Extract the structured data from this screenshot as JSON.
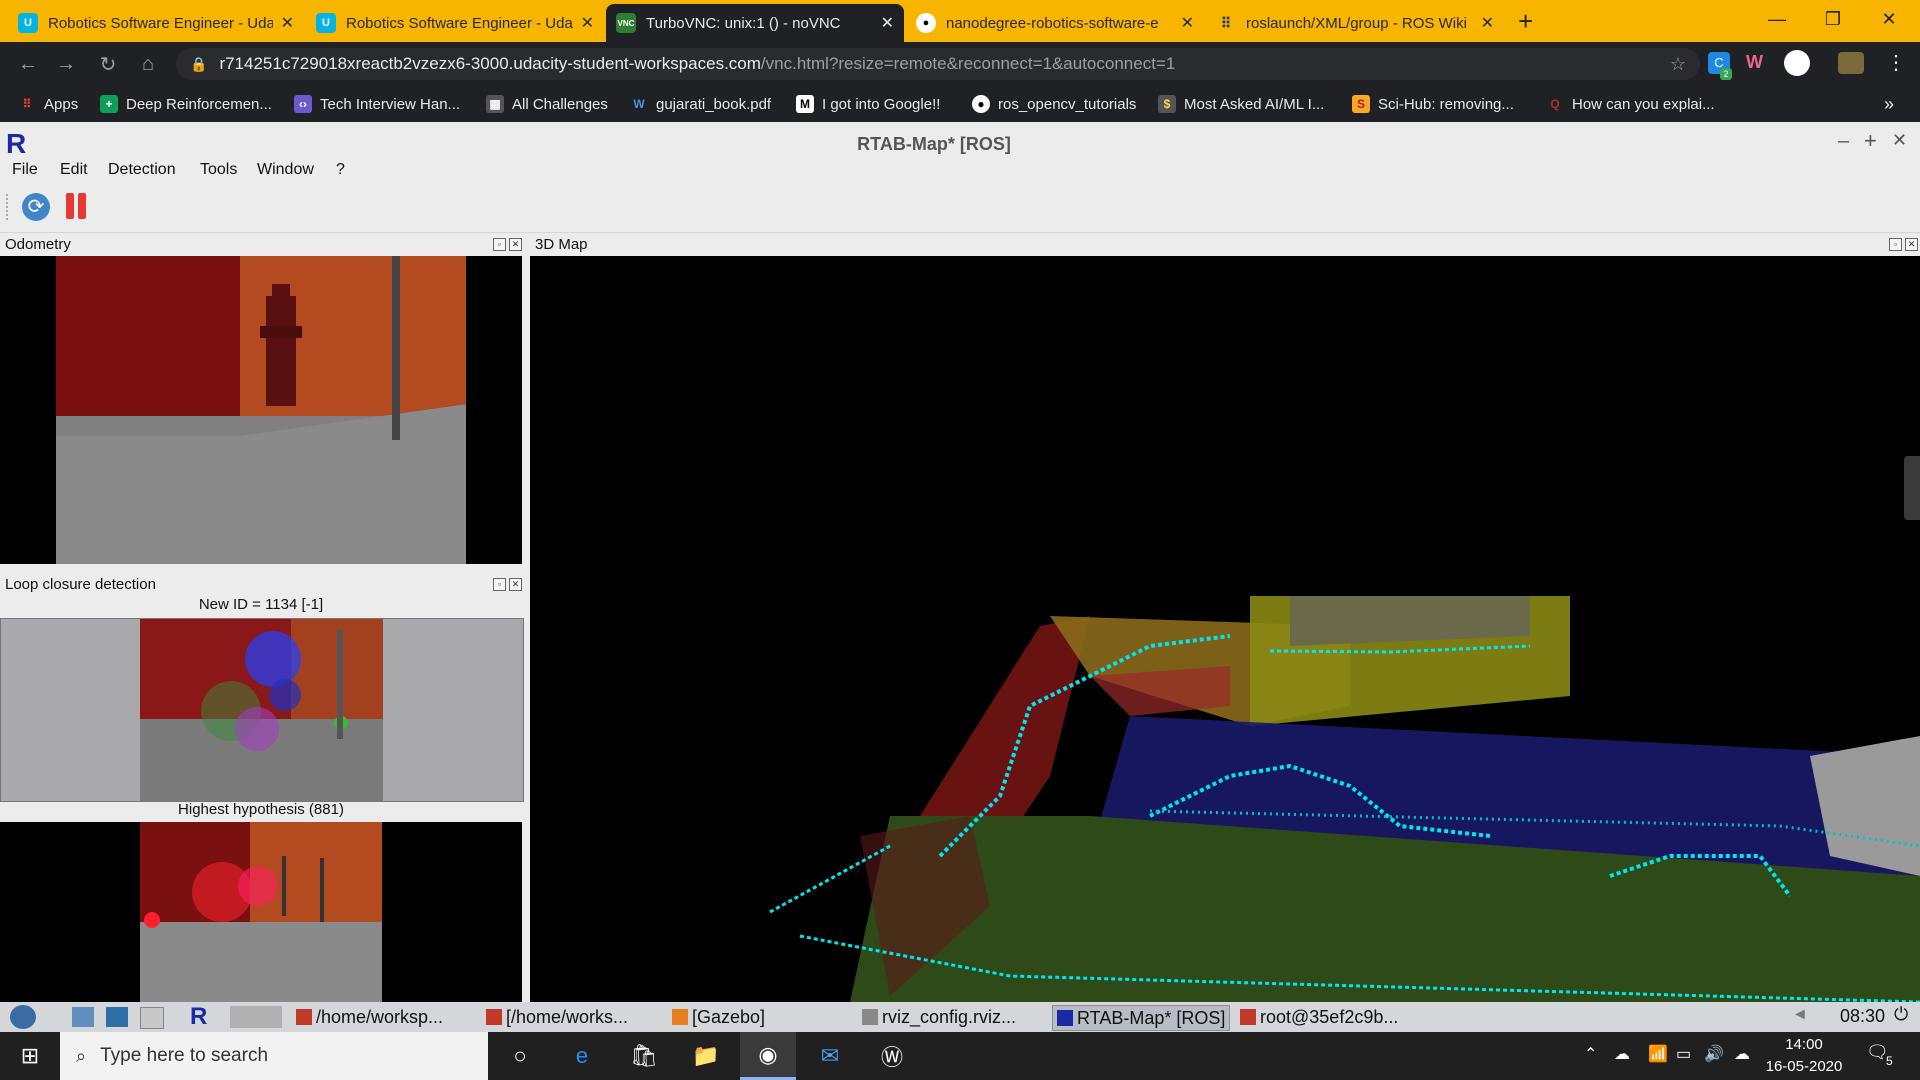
{
  "browser": {
    "tabs": [
      {
        "title": "Robotics Software Engineer - Uda",
        "icon": "udacity-icon"
      },
      {
        "title": "Robotics Software Engineer - Uda",
        "icon": "udacity-icon"
      },
      {
        "title": "TurboVNC: unix:1 () - noVNC",
        "icon": "vnc-icon",
        "active": true
      },
      {
        "title": "nanodegree-robotics-software-e",
        "icon": "github-icon"
      },
      {
        "title": "roslaunch/XML/group - ROS Wiki",
        "icon": "ros-icon"
      }
    ],
    "address_host": "r714251c729018xreactb2vzezx6-3000.udacity-student-workspaces.com",
    "address_path": "/vnc.html?resize=remote&reconnect=1&autoconnect=1",
    "extension_badge": "2",
    "bookmarks": [
      {
        "label": "Apps",
        "icon": "apps-grid-icon"
      },
      {
        "label": "Deep Reinforcemen...",
        "icon": "plus-icon"
      },
      {
        "label": "Tech Interview Han...",
        "icon": "code-icon"
      },
      {
        "label": "All Challenges",
        "icon": "challenge-icon"
      },
      {
        "label": "gujarati_book.pdf",
        "icon": "w-icon"
      },
      {
        "label": "I got into Google!!",
        "icon": "medium-icon"
      },
      {
        "label": "ros_opencv_tutorials",
        "icon": "github-icon"
      },
      {
        "label": "Most Asked AI/ML I...",
        "icon": "dollar-icon"
      },
      {
        "label": "Sci-Hub: removing...",
        "icon": "scihub-icon"
      },
      {
        "label": "How can you explai...",
        "icon": "quora-icon"
      }
    ],
    "overflow_label": "»"
  },
  "app": {
    "logo": "R",
    "title": "RTAB-Map* [ROS]",
    "menus": [
      "File",
      "Edit",
      "Detection",
      "Tools",
      "Window",
      "?"
    ],
    "panels": {
      "odometry": "Odometry",
      "map3d": "3D Map",
      "loop": "Loop closure detection",
      "new_id": "New ID = 1134 [-1]",
      "highest": "Highest hypothesis (881)"
    }
  },
  "lx_taskbar": {
    "tasks": [
      "/home/worksp...",
      "[/home/works...",
      "[Gazebo]",
      "rviz_config.rviz...",
      "RTAB-Map* [ROS]",
      "root@35ef2c9b..."
    ],
    "clock": "08:30"
  },
  "windows_taskbar": {
    "search_placeholder": "Type here to search",
    "time": "14:00",
    "date": "16-05-2020",
    "notification_count": "5"
  }
}
